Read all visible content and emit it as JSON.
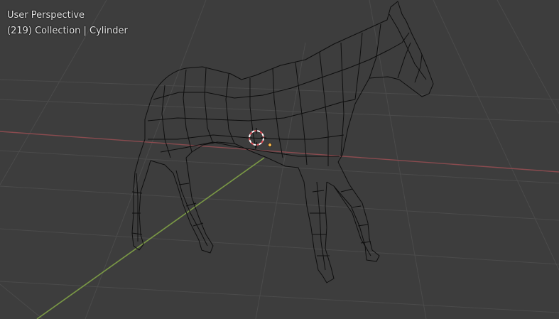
{
  "viewport": {
    "view_name": "User Perspective",
    "object_info": "(219) Collection | Cylinder"
  },
  "colors": {
    "background": "#3d3d3d",
    "grid": "#4a4a4a",
    "x_axis": "#8a4b4f",
    "y_axis": "#6f8d3a",
    "wire": "#0d0d0d",
    "cursor_red": "#e0505a",
    "cursor_white": "#ffffff",
    "origin": "#f2b34b"
  },
  "icons": {
    "3d_cursor": "3d-cursor-icon",
    "origin": "origin-dot-icon"
  }
}
